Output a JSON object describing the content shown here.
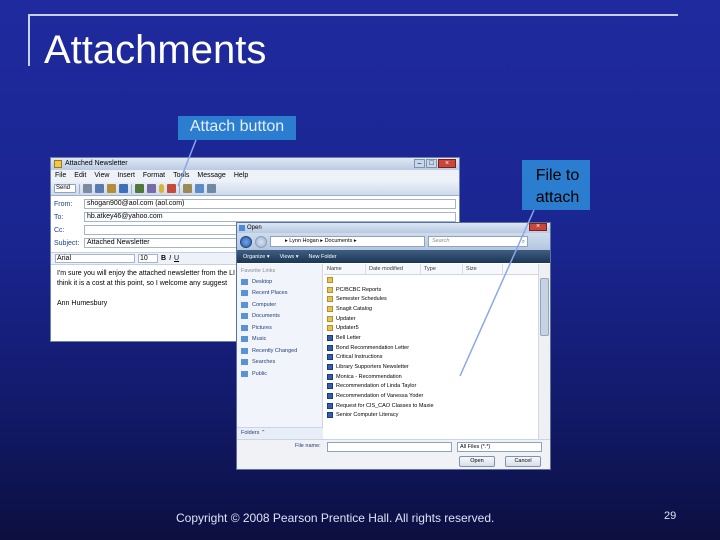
{
  "slide": {
    "title": "Attachments",
    "callouts": {
      "attach": "Attach button",
      "file": "File to attach"
    },
    "footer": "Copyright © 2008 Pearson Prentice Hall. All rights reserved.",
    "page_number": "29"
  },
  "email": {
    "window_title": "Attached Newsletter",
    "menu": [
      "File",
      "Edit",
      "View",
      "Insert",
      "Format",
      "Tools",
      "Message",
      "Help"
    ],
    "send_label": "Send",
    "fields": [
      {
        "label": "From:",
        "value": "shogan900@aol.com (aol.com)"
      },
      {
        "label": "To:",
        "value": "hb.atkey46@yahoo.com"
      },
      {
        "label": "Cc:",
        "value": ""
      },
      {
        "label": "Subject:",
        "value": "Attached Newsletter"
      }
    ],
    "font": "Arial",
    "font_size": "10",
    "body_lines": [
      "I'm sure you will enjoy the attached newsletter from the LI",
      "think it is a cost at this point, so I welcome any suggest",
      "",
      "Ann Humesbury"
    ]
  },
  "dialog": {
    "title": "Open",
    "breadcrumb": "▸ Lynn Hogan ▸ Documents ▸",
    "search_placeholder": "Search",
    "commands": [
      "Organize ▾",
      "Views ▾",
      "New Folder"
    ],
    "favorite_links_header": "Favorite Links",
    "favorites": [
      "Desktop",
      "Recent Places",
      "Computer",
      "Documents",
      "Pictures",
      "Music",
      "Recently Changed",
      "Searches",
      "Public"
    ],
    "folders_label": "Folders",
    "columns": [
      "Name",
      "Date modified",
      "Type",
      "Size"
    ],
    "files": [
      {
        "name": "",
        "kind": "folder"
      },
      {
        "name": "PC/BCBC Reports",
        "kind": "folder"
      },
      {
        "name": "Semester Schedules",
        "kind": "folder"
      },
      {
        "name": "Snagit Catalog",
        "kind": "folder"
      },
      {
        "name": "Updater",
        "kind": "folder"
      },
      {
        "name": "Updater5",
        "kind": "folder"
      },
      {
        "name": "Bell Letter",
        "kind": "doc"
      },
      {
        "name": "Bond Recommendation Letter",
        "kind": "doc"
      },
      {
        "name": "Critical Instructions",
        "kind": "doc"
      },
      {
        "name": "Library Supporters Newsletter",
        "kind": "doc"
      },
      {
        "name": "Monica - Recommendation",
        "kind": "doc"
      },
      {
        "name": "Recommendation of Linda Taylor",
        "kind": "doc"
      },
      {
        "name": "Recommendation of Vanessa Yoder",
        "kind": "doc"
      },
      {
        "name": "Request for CIS_CAO Classes to Maxie",
        "kind": "doc"
      },
      {
        "name": "Senior Computer Literacy",
        "kind": "doc"
      }
    ],
    "file_name_label": "File name:",
    "file_name_value": "",
    "file_type": "All Files (*.*)",
    "open_label": "Open",
    "cancel_label": "Cancel"
  }
}
